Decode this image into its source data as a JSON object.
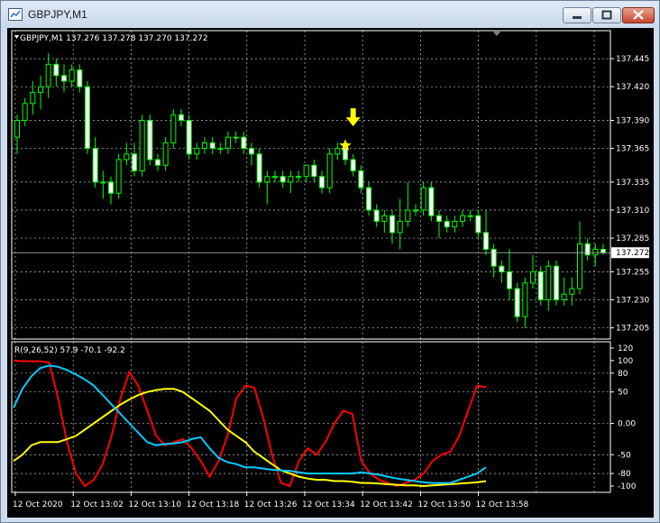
{
  "window": {
    "title": "GBPJPY,M1",
    "buttons": [
      "minimize",
      "maximize",
      "close"
    ]
  },
  "main_chart": {
    "header": "GBPJPY,M1  137.276 137.278 137.270 137.272",
    "current_price": "137.272",
    "price_labels": [
      "137.445",
      "137.420",
      "137.390",
      "137.365",
      "137.335",
      "137.310",
      "137.285",
      "137.255",
      "137.230",
      "137.205"
    ]
  },
  "indicator": {
    "header": "R(9,26,52) 57.9 -70.1 -92.2",
    "scale_labels": [
      "120",
      "100",
      "80",
      "50",
      "0.00",
      "-50",
      "-80",
      "-100"
    ]
  },
  "time_labels": [
    "12 Oct 2020",
    "12 Oct 13:02",
    "12 Oct 13:10",
    "12 Oct 13:18",
    "12 Oct 13:26",
    "12 Oct 13:34",
    "12 Oct 13:42",
    "12 Oct 13:50",
    "12 Oct 13:58"
  ],
  "colors": {
    "background": "#000000",
    "grid": "#c0c0c0",
    "candle": "#00ff00",
    "bull_body": "#000000",
    "bear_body": "#ffffff",
    "signal_arrow": "#ffff00",
    "rsi_fast": "#ff0000",
    "rsi_mid": "#ffff00",
    "rsi_slow": "#00ccff"
  },
  "chart_data": [
    {
      "type": "candlestick",
      "symbol": "GBPJPY",
      "timeframe": "M1",
      "ylim": [
        137.195,
        137.47
      ],
      "y_ticks": [
        137.445,
        137.42,
        137.39,
        137.365,
        137.335,
        137.31,
        137.285,
        137.255,
        137.23,
        137.205
      ],
      "last": 137.272,
      "markers": [
        {
          "type": "arrow-down",
          "color": "#ffff00",
          "at_price": 137.375
        },
        {
          "type": "star",
          "color": "#ffff00",
          "at_price": 137.366
        }
      ],
      "ohlc": [
        [
          137.375,
          137.395,
          137.36,
          137.39
        ],
        [
          137.39,
          137.41,
          137.385,
          137.405
        ],
        [
          137.405,
          137.425,
          137.395,
          137.415
        ],
        [
          137.415,
          137.43,
          137.4,
          137.42
        ],
        [
          137.42,
          137.45,
          137.41,
          137.44
        ],
        [
          137.44,
          137.445,
          137.42,
          137.43
        ],
        [
          137.43,
          137.44,
          137.415,
          137.425
        ],
        [
          137.425,
          137.44,
          137.42,
          137.435
        ],
        [
          137.435,
          137.44,
          137.415,
          137.42
        ],
        [
          137.42,
          137.425,
          137.36,
          137.365
        ],
        [
          137.365,
          137.375,
          137.33,
          137.335
        ],
        [
          137.335,
          137.345,
          137.32,
          137.335
        ],
        [
          137.335,
          137.34,
          137.315,
          137.325
        ],
        [
          137.325,
          137.36,
          137.32,
          137.355
        ],
        [
          137.355,
          137.37,
          137.35,
          137.36
        ],
        [
          137.36,
          137.37,
          137.34,
          137.345
        ],
        [
          137.345,
          137.395,
          137.34,
          137.39
        ],
        [
          137.39,
          137.395,
          137.35,
          137.355
        ],
        [
          137.355,
          137.36,
          137.345,
          137.35
        ],
        [
          137.35,
          137.375,
          137.345,
          137.37
        ],
        [
          137.37,
          137.4,
          137.365,
          137.395
        ],
        [
          137.395,
          137.4,
          137.385,
          137.39
        ],
        [
          137.39,
          137.395,
          137.355,
          137.36
        ],
        [
          137.36,
          137.37,
          137.355,
          137.365
        ],
        [
          137.365,
          137.375,
          137.36,
          137.37
        ],
        [
          137.37,
          137.375,
          137.36,
          137.365
        ],
        [
          137.365,
          137.37,
          137.36,
          137.365
        ],
        [
          137.365,
          137.38,
          137.36,
          137.375
        ],
        [
          137.375,
          137.38,
          137.37,
          137.375
        ],
        [
          137.375,
          137.38,
          137.36,
          137.365
        ],
        [
          137.365,
          137.37,
          137.35,
          137.36
        ],
        [
          137.36,
          137.365,
          137.33,
          137.335
        ],
        [
          137.335,
          137.345,
          137.315,
          137.34
        ],
        [
          137.34,
          137.345,
          137.335,
          137.34
        ],
        [
          137.34,
          137.345,
          137.33,
          137.335
        ],
        [
          137.335,
          137.345,
          137.325,
          137.34
        ],
        [
          137.34,
          137.345,
          137.335,
          137.34
        ],
        [
          137.34,
          137.35,
          137.335,
          137.35
        ],
        [
          137.35,
          137.355,
          137.335,
          137.34
        ],
        [
          137.34,
          137.345,
          137.325,
          137.33
        ],
        [
          137.33,
          137.365,
          137.325,
          137.36
        ],
        [
          137.36,
          137.37,
          137.355,
          137.365
        ],
        [
          137.365,
          137.37,
          137.35,
          137.355
        ],
        [
          137.355,
          137.36,
          137.34,
          137.345
        ],
        [
          137.345,
          137.35,
          137.325,
          137.33
        ],
        [
          137.33,
          137.335,
          137.305,
          137.31
        ],
        [
          137.31,
          137.315,
          137.295,
          137.3
        ],
        [
          137.3,
          137.31,
          137.29,
          137.305
        ],
        [
          137.305,
          137.31,
          137.28,
          137.29
        ],
        [
          137.29,
          137.32,
          137.275,
          137.3
        ],
        [
          137.3,
          137.335,
          137.295,
          137.31
        ],
        [
          137.31,
          137.315,
          137.305,
          137.31
        ],
        [
          137.31,
          137.335,
          137.305,
          137.33
        ],
        [
          137.33,
          137.335,
          137.3,
          137.305
        ],
        [
          137.305,
          137.31,
          137.285,
          137.3
        ],
        [
          137.3,
          137.305,
          137.29,
          137.295
        ],
        [
          137.295,
          137.305,
          137.29,
          137.3
        ],
        [
          137.3,
          137.31,
          137.295,
          137.305
        ],
        [
          137.305,
          137.31,
          137.3,
          137.305
        ],
        [
          137.305,
          137.31,
          137.285,
          137.29
        ],
        [
          137.29,
          137.31,
          137.27,
          137.275
        ],
        [
          137.275,
          137.28,
          137.25,
          137.26
        ],
        [
          137.26,
          137.265,
          137.245,
          137.255
        ],
        [
          137.255,
          137.275,
          137.23,
          137.24
        ],
        [
          137.24,
          137.245,
          137.21,
          137.215
        ],
        [
          137.215,
          137.25,
          137.205,
          137.245
        ],
        [
          137.245,
          137.27,
          137.24,
          137.255
        ],
        [
          137.255,
          137.26,
          137.225,
          137.23
        ],
        [
          137.23,
          137.265,
          137.22,
          137.26
        ],
        [
          137.26,
          137.265,
          137.225,
          137.23
        ],
        [
          137.23,
          137.25,
          137.225,
          137.235
        ],
        [
          137.235,
          137.25,
          137.225,
          137.24
        ],
        [
          137.24,
          137.3,
          137.235,
          137.28
        ],
        [
          137.28,
          137.285,
          137.265,
          137.27
        ],
        [
          137.27,
          137.28,
          137.26,
          137.275
        ],
        [
          137.275,
          137.28,
          137.27,
          137.272
        ]
      ]
    },
    {
      "type": "line",
      "title": "R(9,26,52) 57.9 -70.1 -92.2",
      "ylim": [
        -110,
        130
      ],
      "y_ticks": [
        120,
        100,
        80,
        50,
        0,
        -50,
        -80,
        -100
      ],
      "last_values": [
        57.9,
        -70.1,
        -92.2
      ],
      "series": [
        {
          "color": "#ff0000",
          "values": [
            100,
            99,
            99,
            99,
            97,
            40,
            -30,
            -80,
            -100,
            -90,
            -65,
            -20,
            40,
            82,
            60,
            20,
            -20,
            -35,
            -30,
            -25,
            -40,
            -60,
            -85,
            -60,
            -20,
            40,
            60,
            57,
            10,
            -50,
            -95,
            -100,
            -60,
            -40,
            -50,
            -30,
            0,
            20,
            15,
            -60,
            -80,
            -90,
            -95,
            -100,
            -95,
            -90,
            -80,
            -60,
            -50,
            -45,
            -20,
            20,
            60,
            57.9
          ]
        },
        {
          "color": "#ffff00",
          "values": [
            -60,
            -50,
            -35,
            -30,
            -30,
            -30,
            -25,
            -20,
            -10,
            0,
            10,
            20,
            30,
            38,
            45,
            50,
            53,
            55,
            55,
            50,
            40,
            30,
            20,
            5,
            -10,
            -20,
            -30,
            -45,
            -55,
            -65,
            -75,
            -80,
            -85,
            -88,
            -90,
            -90,
            -92,
            -92,
            -93,
            -95,
            -95,
            -96,
            -97,
            -98,
            -99,
            -99,
            -100,
            -99,
            -98,
            -97,
            -96,
            -95,
            -94,
            -92.2
          ]
        },
        {
          "color": "#00ccff",
          "values": [
            25,
            55,
            75,
            88,
            92,
            90,
            85,
            78,
            70,
            60,
            45,
            30,
            15,
            0,
            -15,
            -30,
            -35,
            -33,
            -32,
            -30,
            -25,
            -22,
            -40,
            -55,
            -62,
            -65,
            -70,
            -70,
            -72,
            -74,
            -75,
            -76,
            -78,
            -80,
            -80,
            -80,
            -80,
            -80,
            -80,
            -78,
            -80,
            -82,
            -85,
            -88,
            -90,
            -92,
            -94,
            -95,
            -95,
            -95,
            -90,
            -85,
            -80,
            -70.1
          ]
        }
      ]
    }
  ]
}
